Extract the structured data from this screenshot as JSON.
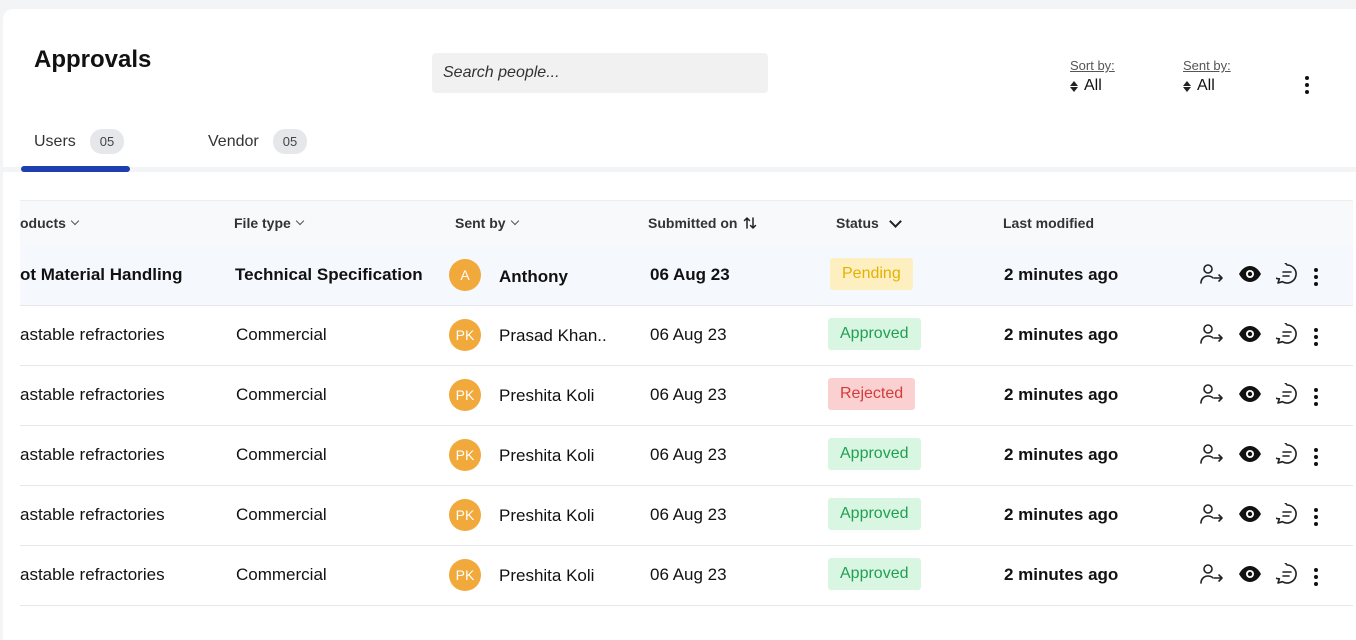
{
  "header": {
    "title": "Approvals"
  },
  "search": {
    "placeholder": "Search people..."
  },
  "sort": {
    "label": "Sort by:",
    "value": "All"
  },
  "sent_filter": {
    "label": "Sent by:",
    "value": "All"
  },
  "tabs": [
    {
      "label": "Users",
      "count": "05",
      "active": true
    },
    {
      "label": "Vendor",
      "count": "05",
      "active": false
    }
  ],
  "columns": {
    "products": "oducts",
    "file_type": "File type",
    "sent_by": "Sent by",
    "submitted_on": "Submitted on",
    "status": "Status",
    "last_modified": "Last modified"
  },
  "rows": [
    {
      "product": "ot Material Handling",
      "file_type": "Technical Specification",
      "initials": "A",
      "sender": "Anthony",
      "submitted": "06 Aug 23",
      "status": "Pending",
      "modified": "2 minutes ago"
    },
    {
      "product": "astable refractories",
      "file_type": "Commercial",
      "initials": "PK",
      "sender": "Prasad Khan..",
      "submitted": "06 Aug 23",
      "status": "Approved",
      "modified": "2 minutes ago"
    },
    {
      "product": "astable refractories",
      "file_type": "Commercial",
      "initials": "PK",
      "sender": "Preshita Koli",
      "submitted": "06 Aug 23",
      "status": "Rejected",
      "modified": "2 minutes ago"
    },
    {
      "product": "astable refractories",
      "file_type": "Commercial",
      "initials": "PK",
      "sender": "Preshita Koli",
      "submitted": "06 Aug 23",
      "status": "Approved",
      "modified": "2 minutes ago"
    },
    {
      "product": "astable refractories",
      "file_type": "Commercial",
      "initials": "PK",
      "sender": "Preshita Koli",
      "submitted": "06 Aug 23",
      "status": "Approved",
      "modified": "2 minutes ago"
    },
    {
      "product": "astable refractories",
      "file_type": "Commercial",
      "initials": "PK",
      "sender": "Preshita Koli",
      "submitted": "06 Aug 23",
      "status": "Approved",
      "modified": "2 minutes ago"
    }
  ],
  "colors": {
    "accent": "#1e40af",
    "avatar": "#f2a93b",
    "pending": "#e5b100",
    "approved": "#22a052",
    "rejected": "#d43c3c"
  },
  "icons": [
    "assign-user-icon",
    "view-eye-icon",
    "comment-icon",
    "more-vertical-icon"
  ]
}
